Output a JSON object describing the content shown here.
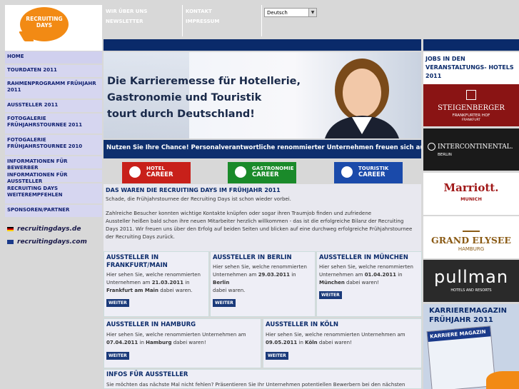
{
  "logo": {
    "line1": "RECRUITING",
    "line2": "DAYS"
  },
  "leftnav": [
    {
      "label": "HOME"
    },
    {
      "label": "TOURDATEN 2011"
    },
    {
      "label": "RAHMENPROGRAMM FRÜHJAHR 2011"
    },
    {
      "label": "AUSSTELLER 2011"
    },
    {
      "label": "FOTOGALERIE FRÜHJAHRSTOURNEE 2011"
    },
    {
      "label": "FOTOGALERIE FRÜHJAHRSTOURNEE 2010"
    },
    {
      "label": "INFORMATIONEN FÜR BEWERBER"
    },
    {
      "label": "INFORMATIONEN FÜR AUSSTELLER"
    },
    {
      "label": "RECRUITING DAYS WEITEREMPFEHLEN"
    },
    {
      "label": "SPONSOREN/PARTNER"
    }
  ],
  "lang_links": {
    "de": "recruitingdays.de",
    "com": "recruitingdays.com"
  },
  "topnav": {
    "wir": "WIR ÜBER UNS",
    "newsletter": "NEWSLETTER",
    "kontakt": "KONTAKT",
    "impressum": "IMPRESSUM",
    "language": "Deutsch"
  },
  "hero": {
    "line1": "Die Karrieremesse für Hotellerie,",
    "line2": "Gastronomie und Touristik",
    "line3": "tourt durch Deutschland!",
    "sub": "Nutzen Sie Ihre Chance! Personalverantwortliche renommierter Unternehmen freuen sich auf Sie!"
  },
  "careers": [
    {
      "l1": "HOTEL",
      "l2": "CAREER",
      "color": "#c8201a"
    },
    {
      "l1": "GASTRONOMIE",
      "l2": "CAREER",
      "color": "#1a8a2a"
    },
    {
      "l1": "TOURISTIK",
      "l2": "CAREER",
      "color": "#1a4aaa"
    }
  ],
  "main": {
    "title": "DAS WAREN DIE RECRUITING DAYS IM FRÜHJAHR 2011",
    "p1": "Schade, die Frühjahrstournee der Recruiting Days ist schon wieder vorbei.",
    "p2a": "Zahlreiche Besucher konnten wichtige Kontakte knüpfen oder sogar ihren Traumjob finden und zufriedene",
    "p2b": "Aussteller heißen bald schon ihre neuen Mitarbeiter herzlich willkommen - das ist die erfolgreiche Bilanz der Recruiting",
    "p2c": "Days 2011. Wir freuen uns über den Erfolg auf beiden Seiten und blicken auf eine durchweg erfolgreiche Frühjahrstournee",
    "p2d": "der Recruiting Days zurück."
  },
  "boxes": {
    "frankfurt": {
      "title1": "AUSSTELLER IN",
      "title2": "FRANKFURT/MAIN",
      "t1": "Hier sehen Sie, welche renommierten",
      "t2": "Unternehmen am",
      "date": "21.03.2011",
      "t3": "in",
      "city": "Frankfurt am Main",
      "t4": "dabei waren."
    },
    "berlin": {
      "title": "AUSSTELLER IN BERLIN",
      "t1": "Hier sehen Sie, welche renommierten",
      "t2": "Unternehmen am",
      "date": "29.03.2011",
      "t3": "in",
      "city": "Berlin",
      "t4": "dabei waren."
    },
    "muenchen": {
      "title": "AUSSTELLER IN MÜNCHEN",
      "t1": "Hier sehen Sie, welche renommierten",
      "t2": "Unternehmen am",
      "date": "01.04.2011",
      "t3": "in",
      "city": "München",
      "t4": "dabei waren!"
    },
    "hamburg": {
      "title": "AUSSTELLER IN HAMBURG",
      "t1": "Hier sehen Sie, welche renommierten Unternehmen am",
      "date": "07.04.2011",
      "t3": "in",
      "city": "Hamburg",
      "t4": "dabei waren!"
    },
    "koeln": {
      "title": "AUSSTELLER IN KÖLN",
      "t1": "Hier sehen Sie, welche renommierten Unternehmen am",
      "date": "09.05.2011",
      "t3": "in",
      "city": "Köln",
      "t4": "dabei waren!"
    },
    "weiter": "WEITER"
  },
  "infos": {
    "title": "INFOS FÜR AUSSTELLER",
    "text": "Sie möchten das nächste Mal nicht fehlen? Präsentieren Sie Ihr Unternehmen potentiellen Bewerbern bei den nächsten"
  },
  "right": {
    "jobs_title": "JOBS IN DEN VERANSTALTUNGS- HOTELS 2011",
    "hotels": [
      {
        "name": "STEIGENBERGER",
        "sub": "FRANKFURTER HOF",
        "sub2": "FRANKFURT",
        "bg": "#8a1414",
        "fg": "#fff"
      },
      {
        "name": "INTERCONTINENTAL.",
        "sub": "BERLIN",
        "bg": "#1a1a1a",
        "fg": "#fff"
      },
      {
        "name": "Marriott.",
        "sub": "MUNICH",
        "bg": "#fff",
        "fg": "#a01818"
      },
      {
        "name": "GRAND ELYSEE",
        "sub": "HAMBURG",
        "bg": "#fff",
        "fg": "#8a5a14"
      },
      {
        "name": "pullman",
        "sub": "HOTELS AND RESORTS",
        "bg": "#2a2a2a",
        "fg": "#fff"
      }
    ],
    "mag1": "KARRIEREMAGAZIN",
    "mag2": "FRÜHJAHR 2011",
    "mag_cover": "KARRIERE MAGAZIN"
  }
}
